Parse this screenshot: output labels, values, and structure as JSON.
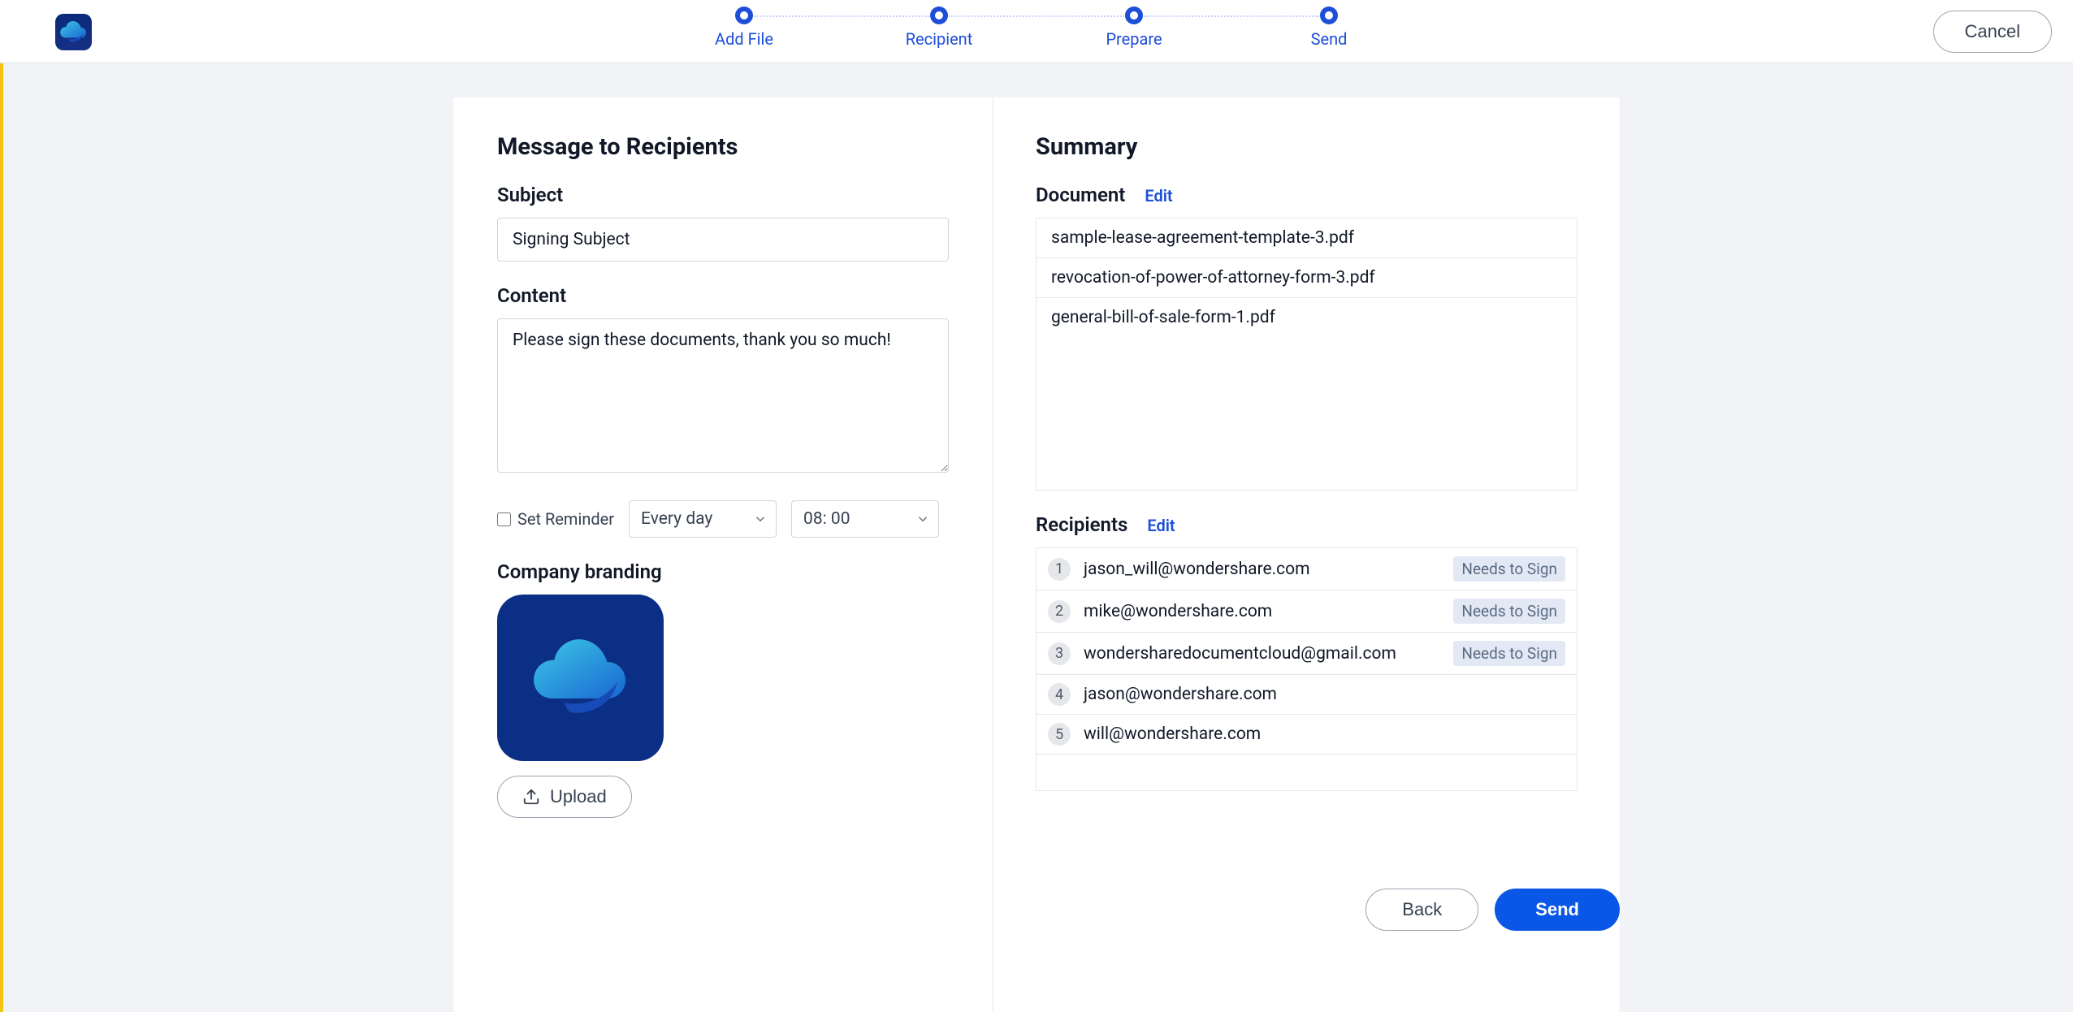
{
  "header": {
    "cancel_label": "Cancel"
  },
  "steps": [
    {
      "label": "Add File"
    },
    {
      "label": "Recipient"
    },
    {
      "label": "Prepare"
    },
    {
      "label": "Send"
    }
  ],
  "message": {
    "title": "Message to Recipients",
    "subject_label": "Subject",
    "subject_value": "Signing Subject",
    "content_label": "Content",
    "content_value": "Please sign these documents, thank you so much!",
    "reminder_label": "Set Reminder",
    "freq_value": "Every day",
    "time_value": "08: 00",
    "branding_label": "Company branding",
    "upload_label": "Upload"
  },
  "summary": {
    "title": "Summary",
    "document_label": "Document",
    "edit_label": "Edit",
    "documents": [
      "sample-lease-agreement-template-3.pdf",
      "revocation-of-power-of-attorney-form-3.pdf",
      "general-bill-of-sale-form-1.pdf"
    ],
    "recipients_label": "Recipients",
    "needs_to_sign": "Needs to Sign",
    "recipients": [
      {
        "n": "1",
        "email": "jason_will@wondershare.com",
        "sign": true
      },
      {
        "n": "2",
        "email": "mike@wondershare.com",
        "sign": true
      },
      {
        "n": "3",
        "email": "wondersharedocumentcloud@gmail.com",
        "sign": true
      },
      {
        "n": "4",
        "email": "jason@wondershare.com",
        "sign": false
      },
      {
        "n": "5",
        "email": "will@wondershare.com",
        "sign": false
      }
    ]
  },
  "footer": {
    "back_label": "Back",
    "send_label": "Send"
  }
}
